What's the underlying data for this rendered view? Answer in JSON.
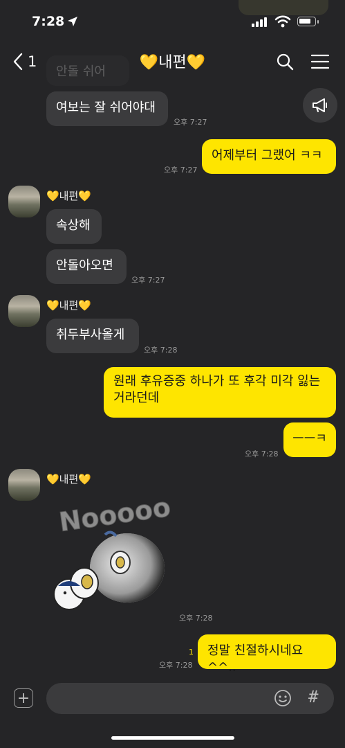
{
  "status": {
    "time": "7:28"
  },
  "header": {
    "back_count": "1",
    "title": "💛내편💛"
  },
  "messages": {
    "faded_prev": "안돌 쉬어",
    "m1_text": "여보는 잘 쉬어야대",
    "m1_time": "오후 7:27",
    "m2_text": "어제부터 그랬어 ㅋㅋ",
    "m2_time": "오후 7:27",
    "sender1": "💛내편💛",
    "m3_text": "속상해",
    "m4_text": "안돌아오면",
    "m4_time": "오후 7:27",
    "sender2": "💛내편💛",
    "m5_text": "취두부사올게",
    "m5_time": "오후 7:28",
    "m6_line1": "원래 후유증중 하나가 또 후각 미각 잃는",
    "m6_line2": "거라던데",
    "m7_text": "ㅡㅡㅋ",
    "m7_time": "오후 7:28",
    "sender3": "💛내편💛",
    "sticker_text": "Nooooo",
    "sticker_time": "오후 7:28",
    "m8_text": "정말 친절하시네요^^..",
    "m8_unread": "1",
    "m8_time": "오후 7:28"
  },
  "composer": {
    "plus": "+",
    "hash": "#"
  },
  "colors": {
    "background": "#252527",
    "sent": "#fee500",
    "received": "#3b3b3d"
  },
  "icons": [
    "location-arrow-icon",
    "signal-icon",
    "wifi-icon",
    "battery-icon",
    "back-chevron-icon",
    "search-icon",
    "menu-icon",
    "megaphone-icon",
    "plus-icon",
    "emoji-icon",
    "hash-icon"
  ]
}
